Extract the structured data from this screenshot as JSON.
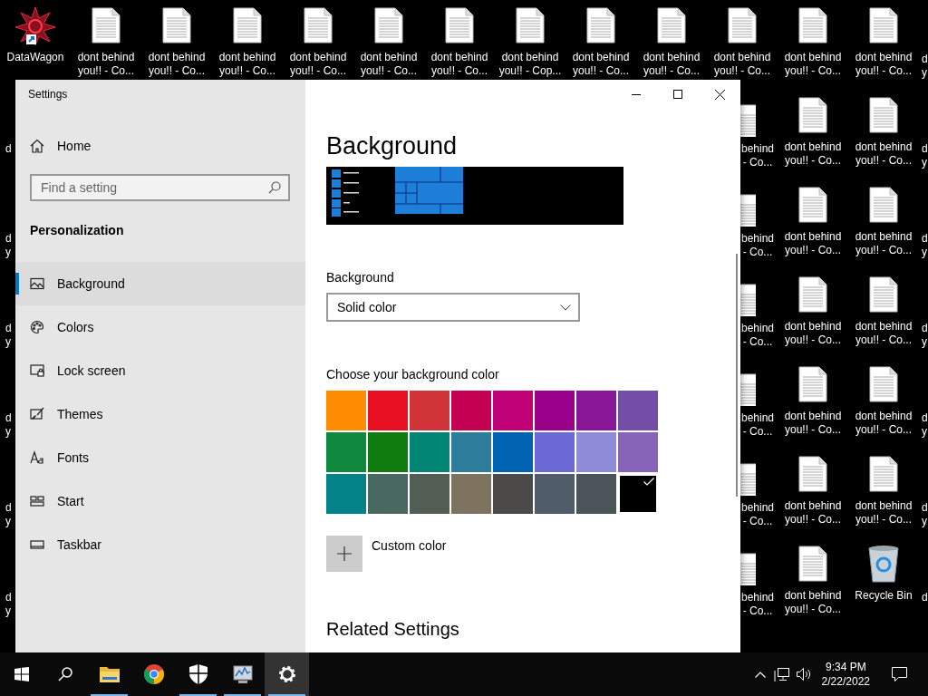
{
  "desktop": {
    "top_row": [
      {
        "kind": "shortcut",
        "label": [
          "DataWagon"
        ]
      },
      {
        "kind": "document",
        "label": [
          "dont behind",
          "you!! - Co..."
        ]
      },
      {
        "kind": "document",
        "label": [
          "dont behind",
          "you!! - Co..."
        ]
      },
      {
        "kind": "document",
        "label": [
          "dont behind",
          "you!! - Co..."
        ]
      },
      {
        "kind": "document",
        "label": [
          "dont behind",
          "you!! - Co..."
        ]
      },
      {
        "kind": "document",
        "label": [
          "dont behind",
          "you!! - Co..."
        ]
      },
      {
        "kind": "document",
        "label": [
          "dont behind",
          "you!! - Co..."
        ]
      },
      {
        "kind": "document",
        "label": [
          "dont behind",
          "you!! - Cop..."
        ]
      },
      {
        "kind": "document",
        "label": [
          "dont behind",
          "you!! - Co..."
        ]
      },
      {
        "kind": "document",
        "label": [
          "dont behind",
          "you!! - Co..."
        ]
      },
      {
        "kind": "document",
        "label": [
          "dont behind",
          "you!! - Co..."
        ]
      },
      {
        "kind": "document",
        "label": [
          "dont behind",
          "you!! - Co..."
        ]
      },
      {
        "kind": "document",
        "label": [
          "dont behind",
          "you!! - Co..."
        ]
      }
    ],
    "left_edge_labels": [
      [
        "d"
      ],
      [
        "d",
        "y"
      ],
      [
        "d",
        "y"
      ],
      [
        "d",
        "y"
      ],
      [
        "d",
        "y"
      ],
      [
        "d",
        "y"
      ]
    ],
    "window_edge_labels": [
      [
        "behind",
        "- Co..."
      ],
      [
        "behind",
        "- Co..."
      ],
      [
        "behind",
        "- Co..."
      ],
      [
        "behind",
        "- Co..."
      ],
      [
        "behind",
        "- Co..."
      ],
      [
        "behind",
        "- Co..."
      ]
    ],
    "icon_rows": [
      [
        {
          "kind": "document",
          "label": [
            "dont behind",
            "you!! - Co..."
          ]
        },
        {
          "kind": "document",
          "label": [
            "dont behind",
            "you!! - Co..."
          ]
        }
      ],
      [
        {
          "kind": "document",
          "label": [
            "dont behind",
            "you!! - Co..."
          ]
        },
        {
          "kind": "document",
          "label": [
            "dont behind",
            "you!! - Co..."
          ]
        }
      ],
      [
        {
          "kind": "document",
          "label": [
            "dont behind",
            "you!! - Co..."
          ]
        },
        {
          "kind": "document",
          "label": [
            "dont behind",
            "you!! - Co..."
          ]
        }
      ],
      [
        {
          "kind": "document",
          "label": [
            "dont behind",
            "you!! - Co..."
          ]
        },
        {
          "kind": "document",
          "label": [
            "dont behind",
            "you!! - Co..."
          ]
        }
      ],
      [
        {
          "kind": "document",
          "label": [
            "dont behind",
            "you!! - Co..."
          ]
        },
        {
          "kind": "document",
          "label": [
            "dont behind",
            "you!! - Co..."
          ]
        }
      ],
      [
        {
          "kind": "document",
          "label": [
            "dont behind",
            "you!! - Co..."
          ]
        },
        {
          "kind": "recycle_bin",
          "label": [
            "Recycle Bin"
          ]
        }
      ]
    ],
    "right_edge_labels": [
      [
        "d",
        "y"
      ],
      [
        "d",
        "y"
      ],
      [
        "d",
        "y"
      ],
      [
        "d",
        "y"
      ],
      [
        "d",
        "y"
      ],
      [
        "d",
        "y"
      ],
      [
        "d"
      ]
    ]
  },
  "window": {
    "title": "Settings",
    "sidebar": {
      "home": "Home",
      "search": {
        "placeholder": "Find a setting"
      },
      "section": "Personalization",
      "items": [
        {
          "kind": "background",
          "label": "Background",
          "selected": true
        },
        {
          "kind": "colors",
          "label": "Colors",
          "selected": false
        },
        {
          "kind": "lock_screen",
          "label": "Lock screen",
          "selected": false
        },
        {
          "kind": "themes",
          "label": "Themes",
          "selected": false
        },
        {
          "kind": "fonts",
          "label": "Fonts",
          "selected": false
        },
        {
          "kind": "start",
          "label": "Start",
          "selected": false
        },
        {
          "kind": "taskbar",
          "label": "Taskbar",
          "selected": false
        }
      ]
    },
    "page": {
      "heading": "Background",
      "background_label": "Background",
      "background_value": "Solid color",
      "color_prompt": "Choose your background color",
      "swatches": [
        {
          "color": "#ff8c00",
          "selected": false
        },
        {
          "color": "#e81123",
          "selected": false
        },
        {
          "color": "#d13438",
          "selected": false
        },
        {
          "color": "#c30052",
          "selected": false
        },
        {
          "color": "#bf0077",
          "selected": false
        },
        {
          "color": "#9a0089",
          "selected": false
        },
        {
          "color": "#881798",
          "selected": false
        },
        {
          "color": "#744da9",
          "selected": false
        },
        {
          "color": "#10893e",
          "selected": false
        },
        {
          "color": "#107c10",
          "selected": false
        },
        {
          "color": "#018574",
          "selected": false
        },
        {
          "color": "#2d7d9a",
          "selected": false
        },
        {
          "color": "#0063b1",
          "selected": false
        },
        {
          "color": "#6b69d6",
          "selected": false
        },
        {
          "color": "#8e8cd8",
          "selected": false
        },
        {
          "color": "#8764b8",
          "selected": false
        },
        {
          "color": "#038387",
          "selected": false
        },
        {
          "color": "#486860",
          "selected": false
        },
        {
          "color": "#525e54",
          "selected": false
        },
        {
          "color": "#7e735f",
          "selected": false
        },
        {
          "color": "#4c4a48",
          "selected": false
        },
        {
          "color": "#515c6b",
          "selected": false
        },
        {
          "color": "#4a5459",
          "selected": false
        },
        {
          "color": "#000000",
          "selected": true
        }
      ],
      "custom_color": "Custom color",
      "related_heading": "Related Settings"
    }
  },
  "taskbar": {
    "apps": [
      {
        "kind": "file_explorer",
        "running": true,
        "selected": false
      },
      {
        "kind": "chrome",
        "running": false,
        "selected": false
      },
      {
        "kind": "security",
        "running": true,
        "selected": false
      },
      {
        "kind": "monitor",
        "running": true,
        "selected": false
      },
      {
        "kind": "settings",
        "running": true,
        "selected": true
      }
    ],
    "clock": {
      "time": "9:34 PM",
      "date": "2/22/2022"
    }
  }
}
